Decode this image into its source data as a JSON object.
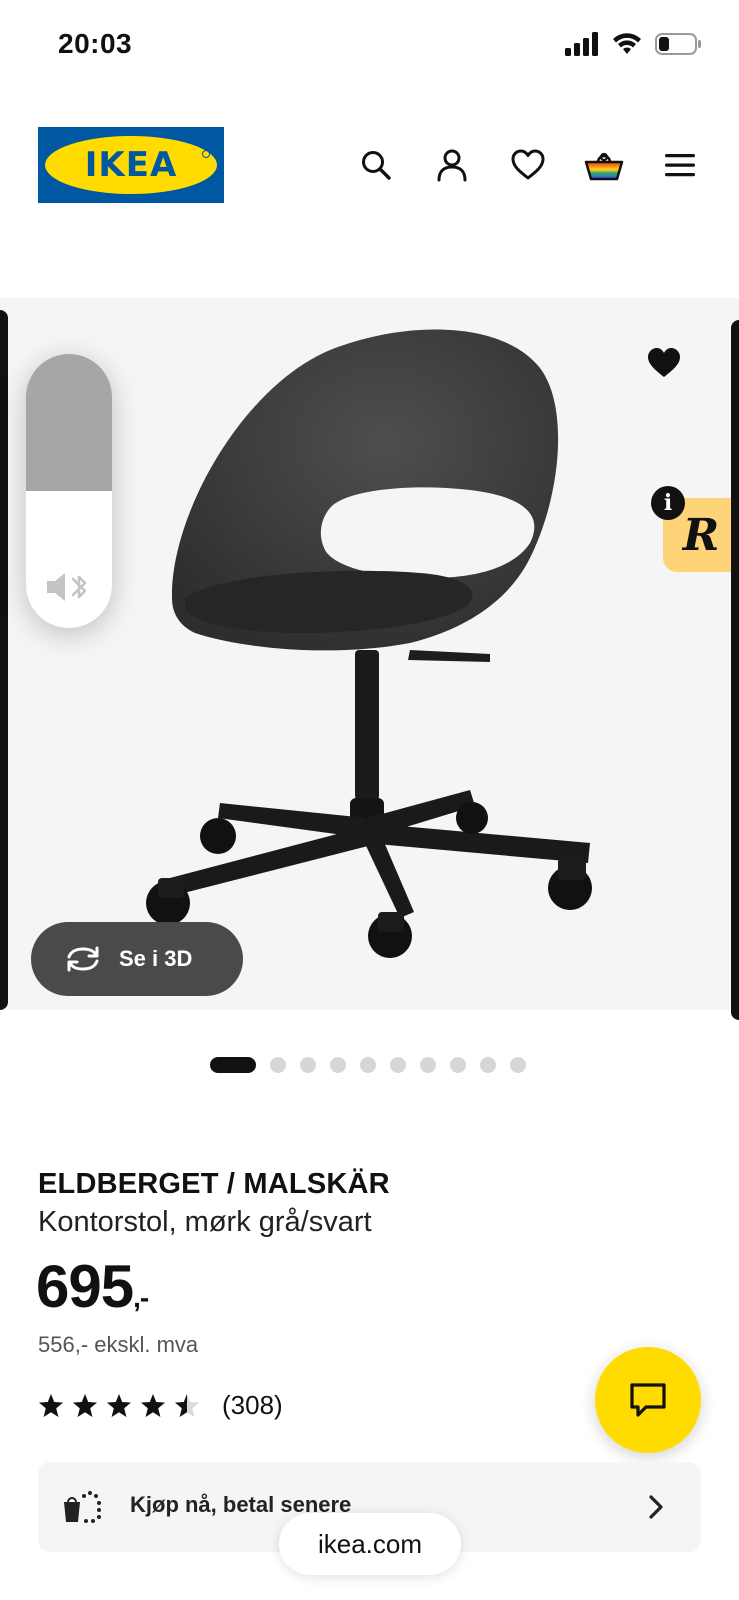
{
  "status_bar": {
    "time": "20:03",
    "icons": [
      "signal-icon",
      "wifi-icon",
      "battery-icon"
    ]
  },
  "header": {
    "logo_text": "IKEA",
    "nav": [
      {
        "name": "search-icon",
        "label": "Søk"
      },
      {
        "name": "account-icon",
        "label": "Konto"
      },
      {
        "name": "favorites-icon",
        "label": "Favoritter"
      },
      {
        "name": "cart-icon",
        "label": "Handlekurv"
      },
      {
        "name": "menu-icon",
        "label": "Meny"
      }
    ]
  },
  "gallery": {
    "image_alt": "ELDBERGET / MALSKÄR kontorstol",
    "view_3d_label": "Se i 3D",
    "badge_letter": "R",
    "badge_info": "i",
    "dots_total": 10,
    "dots_active_index": 0
  },
  "volume_hud": {
    "level": 0.5
  },
  "product": {
    "name": "ELDBERGET / MALSKÄR",
    "description": "Kontorstol, mørk grå/svart",
    "price": "695",
    "price_suffix": ",-",
    "price_ex_vat": "556,- ekskl. mva",
    "rating": 4.5,
    "rating_max": 5,
    "review_count": "(308)"
  },
  "bnpl": {
    "label": "Kjøp nå, betal senere"
  },
  "browser": {
    "url": "ikea.com"
  },
  "colors": {
    "ikea_blue": "#0058a3",
    "ikea_yellow": "#ffdb00",
    "chair_dark": "#3a3a3a"
  }
}
